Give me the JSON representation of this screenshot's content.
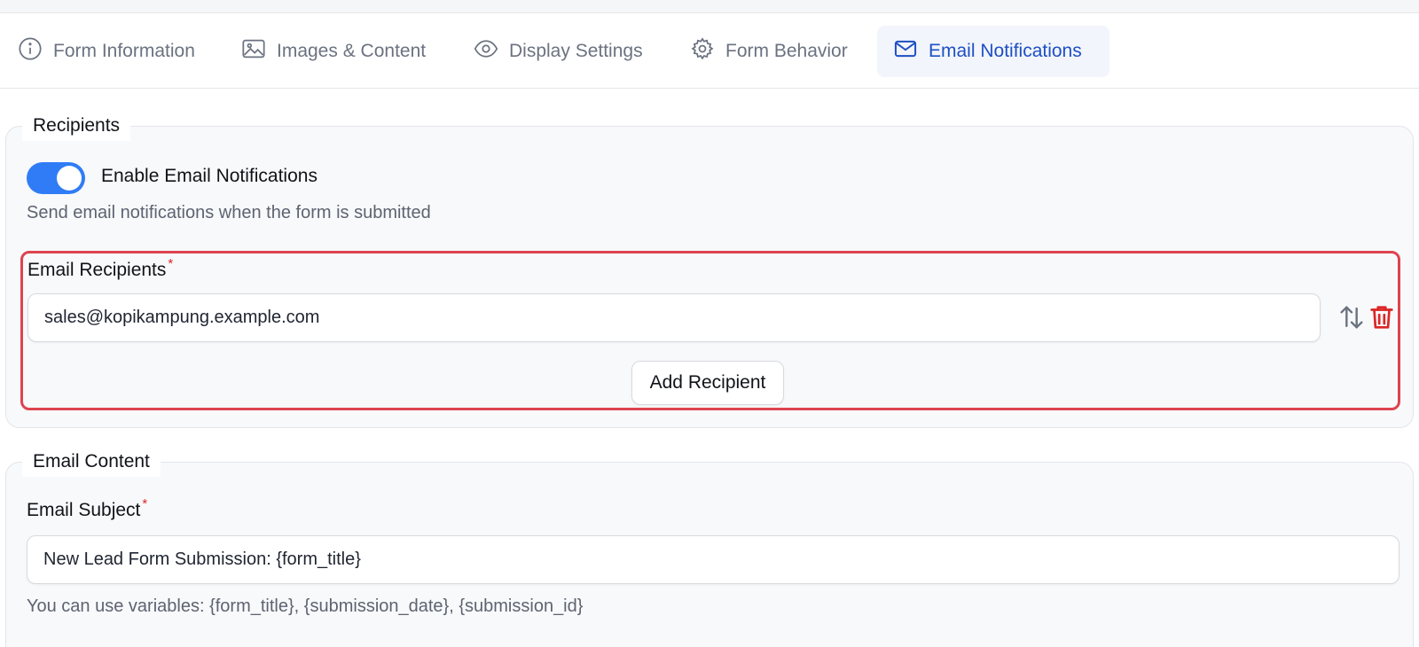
{
  "tabs": [
    {
      "label": "Form Information",
      "icon": "info-icon",
      "active": false
    },
    {
      "label": "Images & Content",
      "icon": "image-icon",
      "active": false
    },
    {
      "label": "Display Settings",
      "icon": "eye-icon",
      "active": false
    },
    {
      "label": "Form Behavior",
      "icon": "gear-icon",
      "active": false
    },
    {
      "label": "Email Notifications",
      "icon": "mail-icon",
      "active": true
    }
  ],
  "recipients": {
    "legend": "Recipients",
    "toggle_label": "Enable Email Notifications",
    "toggle_on": true,
    "help": "Send email notifications when the form is submitted",
    "field_label": "Email Recipients",
    "required_mark": "*",
    "recipient_value": "sales@kopikampung.example.com",
    "add_button": "Add Recipient"
  },
  "content": {
    "legend": "Email Content",
    "subject_label": "Email Subject",
    "required_mark": "*",
    "subject_value": "New Lead Form Submission: {form_title}",
    "variables_help": "You can use variables: {form_title}, {submission_date}, {submission_id}"
  },
  "colors": {
    "accent": "#2f7cf6",
    "active_tab_text": "#1e4fc4",
    "error_border": "#dd4450",
    "delete_icon": "#dc2626"
  }
}
